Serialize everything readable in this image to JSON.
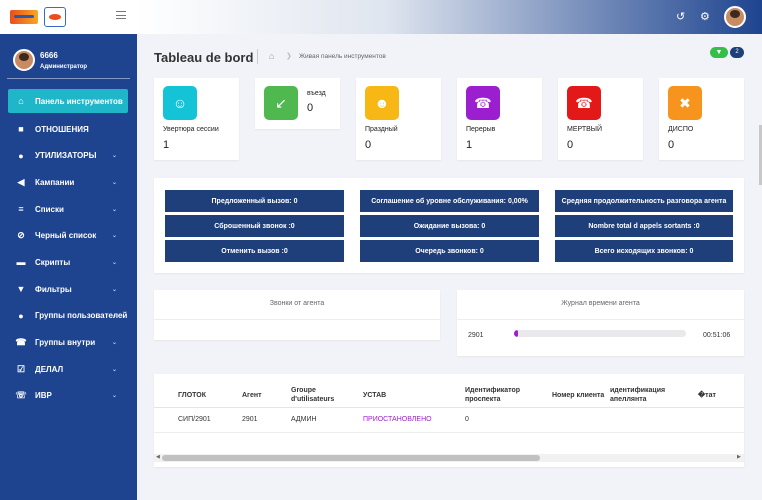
{
  "sidebar": {
    "user_name": "6666",
    "user_role": "Администратор",
    "items": [
      {
        "label": "Панель инструментов",
        "icon": "dashboard-icon",
        "glyph": "⌂",
        "active": true
      },
      {
        "label": "ОТНОШЕНИЯ",
        "icon": "document-icon",
        "glyph": "■"
      },
      {
        "label": "УТИЛИЗАТОРЫ",
        "icon": "user-icon",
        "glyph": "●"
      },
      {
        "label": "Кампании",
        "icon": "megaphone-icon",
        "glyph": "◀"
      },
      {
        "label": "Списки",
        "icon": "list-icon",
        "glyph": "≡"
      },
      {
        "label": "Черный список",
        "icon": "blocked-phone-icon",
        "glyph": "⊘"
      },
      {
        "label": "Скрипты",
        "icon": "card-icon",
        "glyph": "▬"
      },
      {
        "label": "Фильтры",
        "icon": "filter-icon",
        "glyph": "▼"
      },
      {
        "label": "Группы пользователей",
        "icon": "users-icon",
        "glyph": "●"
      },
      {
        "label": "Группы внутри",
        "icon": "phone-icon",
        "glyph": "☎"
      },
      {
        "label": "ДЕЛАЛ",
        "icon": "checklist-icon",
        "glyph": "☑"
      },
      {
        "label": "ИВР",
        "icon": "phone-wave-icon",
        "glyph": "☏"
      }
    ]
  },
  "header": {
    "title": "Tableau de bord",
    "breadcrumb": "Живая панель инструментов",
    "filter_count": "2"
  },
  "stats": [
    {
      "label": "Увертюра сессии",
      "value": "1",
      "color": "#14c3d6",
      "icon": "users-icon",
      "glyph": "☺"
    },
    {
      "label": "въезд",
      "value": "0",
      "color": "#4fb84f",
      "icon": "incoming-call-icon",
      "glyph": "↙"
    },
    {
      "label": "Праздный",
      "value": "0",
      "color": "#f7b815",
      "icon": "user-clock-icon",
      "glyph": "☻"
    },
    {
      "label": "Перерыв",
      "value": "1",
      "color": "#9b1fcf",
      "icon": "phone-pause-icon",
      "glyph": "☎"
    },
    {
      "label": "МЕРТВЫЙ",
      "value": "0",
      "color": "#e31919",
      "icon": "hangup-icon",
      "glyph": "☎"
    },
    {
      "label": "ДИСПО",
      "value": "0",
      "color": "#f7941d",
      "icon": "phone-slash-icon",
      "glyph": "✖"
    }
  ],
  "summary": [
    [
      "Предложенный вызов: 0",
      "Сброшенный звонок :0",
      "Отменить вызов :0"
    ],
    [
      "Соглашение об уровне обслуживания: 0,00%",
      "Ожидание вызова: 0",
      "Очередь звонков: 0"
    ],
    [
      "Средняя продолжительность разговора агента",
      "Nombre total d appels sortants :0",
      "Всего исходящих звонков: 0"
    ]
  ],
  "panels": {
    "agent_calls_title": "Звонки от агента",
    "agent_time_title": "Журнал времени агента",
    "agent_time_row": {
      "agent": "2901",
      "progress": 0.02,
      "time": "00:51:06",
      "bar_color": "#9b1fcf"
    }
  },
  "table": {
    "headers": [
      "ГЛОТОК",
      "Агент",
      "Groupe d'utilisateurs",
      "УСТАВ",
      "Идентификатор проспекта",
      "Номер клиента",
      "идентификация апеллянта",
      "�тат"
    ],
    "rows": [
      [
        "СИП/2901",
        "2901",
        "АДМИН",
        "ПРИОСТАНОВЛЕНО",
        "0",
        "",
        "",
        ""
      ]
    ],
    "status_color": "#9b1fcf"
  }
}
